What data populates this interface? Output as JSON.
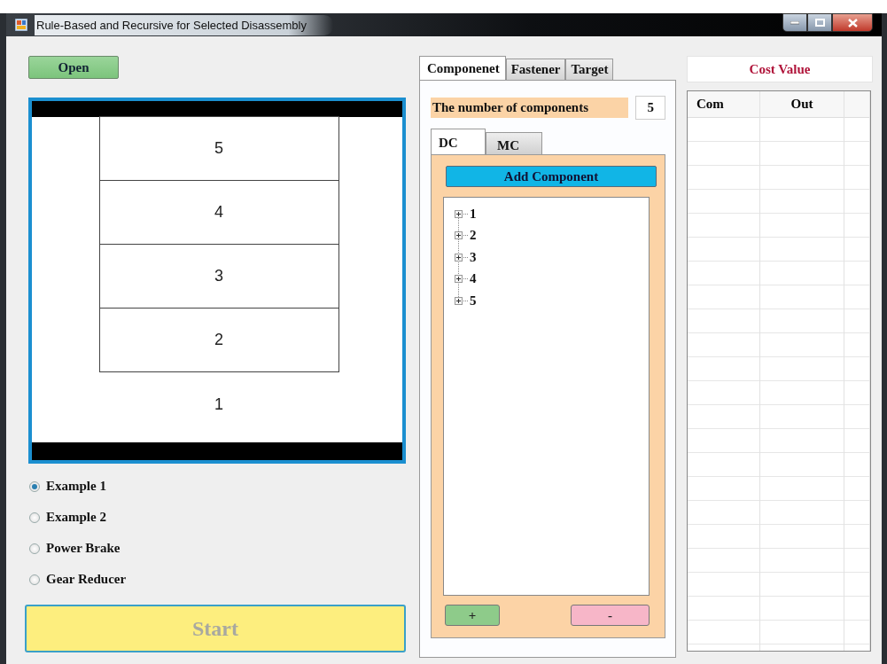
{
  "window": {
    "title": "Rule-Based and Recursive for Selected Disassembly"
  },
  "open_button": "Open",
  "diagram": {
    "blocks": [
      {
        "label": "5",
        "boxed": true
      },
      {
        "label": "4",
        "boxed": true
      },
      {
        "label": "3",
        "boxed": true
      },
      {
        "label": "2",
        "boxed": true
      },
      {
        "label": "1",
        "boxed": false
      }
    ]
  },
  "examples": [
    {
      "label": "Example 1",
      "selected": true
    },
    {
      "label": "Example 2",
      "selected": false
    },
    {
      "label": "Power Brake",
      "selected": false
    },
    {
      "label": "Gear Reducer",
      "selected": false
    }
  ],
  "start_button": {
    "label": "Start",
    "disabled": true
  },
  "tabs": [
    {
      "label": "Componenet",
      "selected": true
    },
    {
      "label": "Fastener",
      "selected": false
    },
    {
      "label": "Target",
      "selected": false
    }
  ],
  "component_count": {
    "label": "The number of components",
    "value": "5"
  },
  "sub_tabs": [
    {
      "label": "DC",
      "selected": true
    },
    {
      "label": "MC",
      "selected": false
    }
  ],
  "add_component_button": "Add Component",
  "component_tree": [
    {
      "label": "1",
      "expanded": false
    },
    {
      "label": "2",
      "expanded": false
    },
    {
      "label": "3",
      "expanded": false
    },
    {
      "label": "4",
      "expanded": false
    },
    {
      "label": "5",
      "expanded": false
    }
  ],
  "add_button": "+",
  "remove_button": "-",
  "cost_value": {
    "title": "Cost Value",
    "columns": [
      "Com",
      "Out"
    ]
  }
}
